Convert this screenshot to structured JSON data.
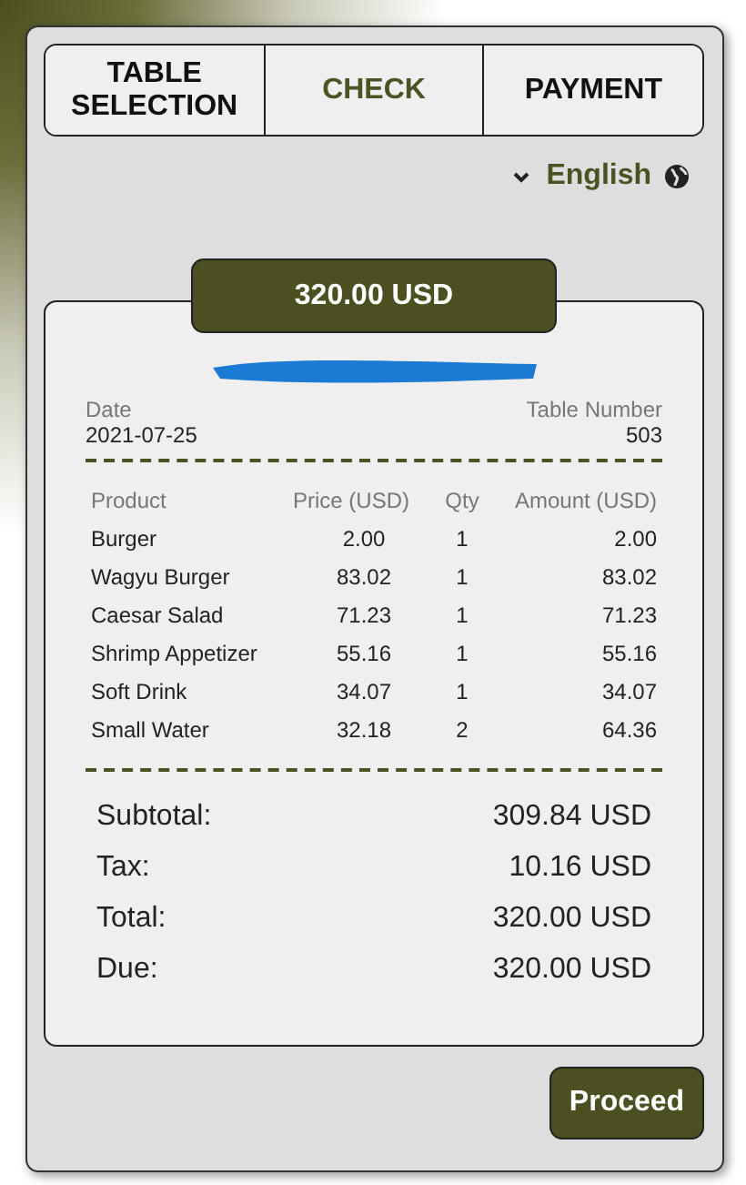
{
  "tabs": [
    {
      "label": "TABLE SELECTION",
      "selected": false
    },
    {
      "label": "CHECK",
      "selected": true
    },
    {
      "label": "PAYMENT",
      "selected": false
    }
  ],
  "language": {
    "label": "English"
  },
  "total_badge": "320.00 USD",
  "receipt": {
    "date_label": "Date",
    "date": "2021-07-25",
    "table_label": "Table Number",
    "table": "503",
    "columns": [
      "Product",
      "Price (USD)",
      "Qty",
      "Amount (USD)"
    ],
    "rows": [
      {
        "product": "Burger",
        "price": "2.00",
        "qty": "1",
        "amount": "2.00"
      },
      {
        "product": "Wagyu Burger",
        "price": "83.02",
        "qty": "1",
        "amount": "83.02"
      },
      {
        "product": "Caesar Salad",
        "price": "71.23",
        "qty": "1",
        "amount": "71.23"
      },
      {
        "product": "Shrimp Appetizer",
        "price": "55.16",
        "qty": "1",
        "amount": "55.16"
      },
      {
        "product": "Soft Drink",
        "price": "34.07",
        "qty": "1",
        "amount": "34.07"
      },
      {
        "product": "Small Water",
        "price": "32.18",
        "qty": "2",
        "amount": "64.36"
      }
    ],
    "summary": [
      {
        "label": "Subtotal:",
        "value": "309.84 USD"
      },
      {
        "label": "Tax:",
        "value": "10.16 USD"
      },
      {
        "label": "Total:",
        "value": "320.00 USD"
      },
      {
        "label": "Due:",
        "value": "320.00 USD"
      }
    ]
  },
  "proceed_button": "Proceed"
}
